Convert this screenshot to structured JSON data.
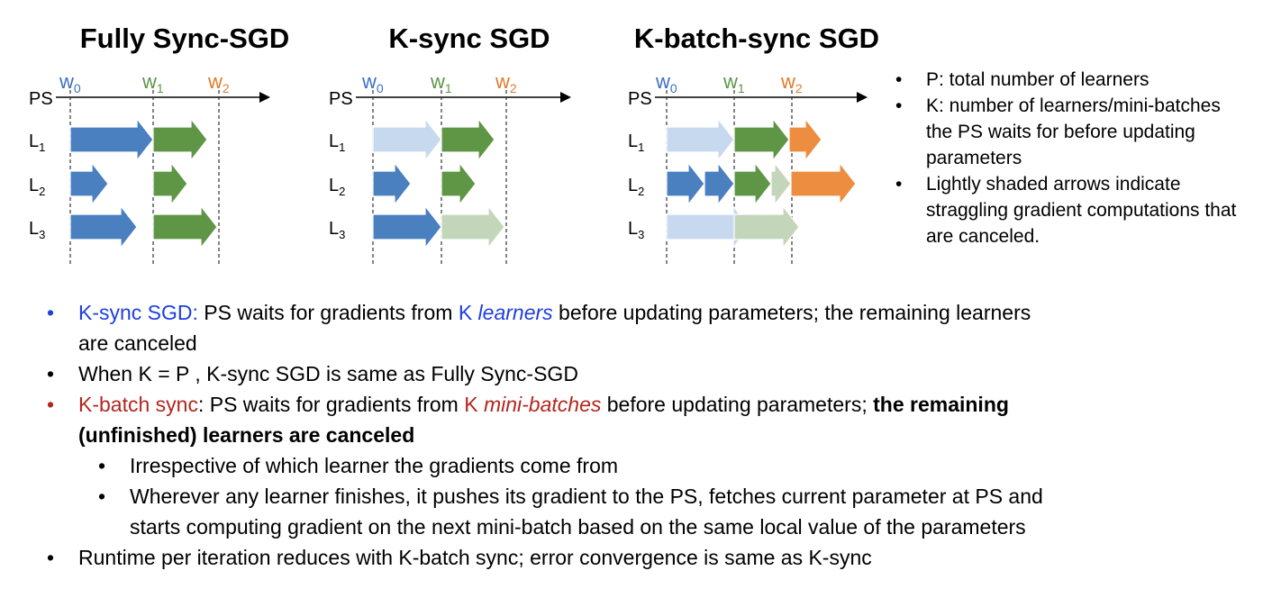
{
  "panels": [
    {
      "title": "Fully Sync-SGD",
      "ps_label": "PS",
      "weights": [
        {
          "base": "w",
          "sub": "0"
        },
        {
          "base": "w",
          "sub": "1"
        },
        {
          "base": "w",
          "sub": "2"
        }
      ],
      "learners": [
        {
          "base": "L",
          "sub": "1"
        },
        {
          "base": "L",
          "sub": "2"
        },
        {
          "base": "L",
          "sub": "3"
        }
      ]
    },
    {
      "title": "K-sync SGD",
      "ps_label": "PS",
      "weights": [
        {
          "base": "w",
          "sub": "0"
        },
        {
          "base": "w",
          "sub": "1"
        },
        {
          "base": "w",
          "sub": "2"
        }
      ],
      "learners": [
        {
          "base": "L",
          "sub": "1"
        },
        {
          "base": "L",
          "sub": "2"
        },
        {
          "base": "L",
          "sub": "3"
        }
      ]
    },
    {
      "title": "K-batch-sync SGD",
      "ps_label": "PS",
      "weights": [
        {
          "base": "w",
          "sub": "0"
        },
        {
          "base": "w",
          "sub": "1"
        },
        {
          "base": "w",
          "sub": "2"
        }
      ],
      "learners": [
        {
          "base": "L",
          "sub": "1"
        },
        {
          "base": "L",
          "sub": "2"
        },
        {
          "base": "L",
          "sub": "3"
        }
      ]
    }
  ],
  "colors": {
    "blue": "#4a7fc0",
    "blue_light": "#c7d9ee",
    "green": "#5e9646",
    "green_light": "#c3d6ba",
    "orange": "#ec8d3f",
    "w0": "#3b6fc4",
    "w1": "#5e9646",
    "w2": "#e07b2c",
    "accent_blue": "#1f3fe0",
    "accent_red": "#b3261e"
  },
  "side_notes": [
    "P: total number of learners",
    "K: number of learners/mini-batches the PS waits for before updating parameters",
    "Lightly shaded arrows indicate straggling gradient computations that are canceled."
  ],
  "bullets": {
    "b1": {
      "label": "K-sync SGD:",
      "t1": " PS waits for gradients from ",
      "k": "K ",
      "kword": "learners",
      "t2": " before updating parameters; the remaining learners are canceled"
    },
    "b2": "When K = P , K-sync SGD is same as Fully Sync-SGD",
    "b3": {
      "label": "K-batch sync",
      "t1": ":  PS waits for gradients from ",
      "k": "K ",
      "kword": "mini-batches",
      "t2": " before updating parameters; ",
      "bold": "the remaining (unfinished) learners are canceled"
    },
    "b3_sub": [
      "Irrespective of which learner the gradients come from",
      "Wherever any learner finishes, it pushes its gradient to the PS, fetches current parameter at PS and starts computing gradient on the next mini-batch based on the same local value of the parameters"
    ],
    "b4": "Runtime per iteration reduces with K-batch sync; error convergence is same as K-sync"
  }
}
